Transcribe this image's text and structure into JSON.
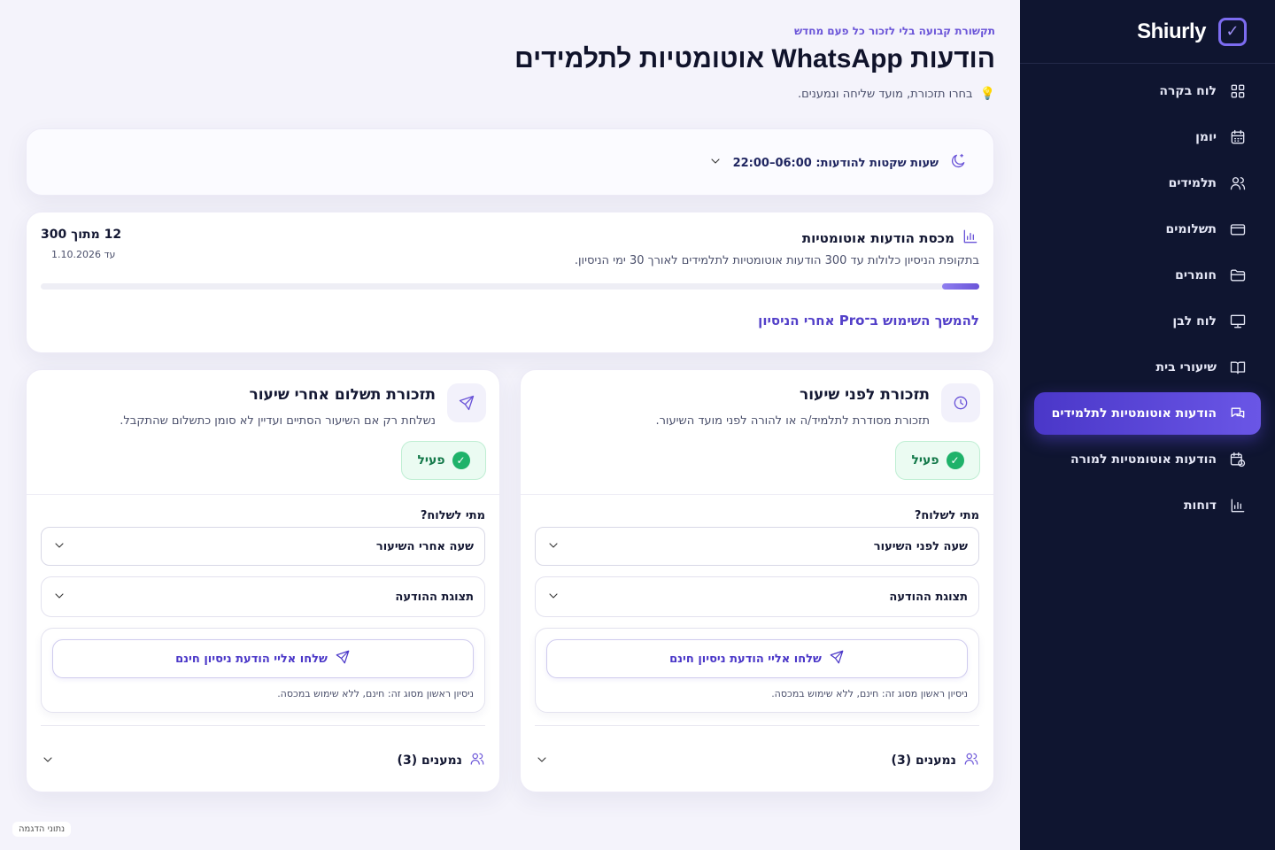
{
  "app": {
    "name": "Shiurly"
  },
  "sidebar": {
    "items": [
      {
        "label": "לוח בקרה",
        "icon": "dashboard-icon",
        "active": false
      },
      {
        "label": "יומן",
        "icon": "calendar-icon",
        "active": false
      },
      {
        "label": "תלמידים",
        "icon": "users-icon",
        "active": false
      },
      {
        "label": "תשלומים",
        "icon": "credit-card-icon",
        "active": false
      },
      {
        "label": "חומרים",
        "icon": "folder-icon",
        "active": false
      },
      {
        "label": "לוח לבן",
        "icon": "whiteboard-icon",
        "active": false
      },
      {
        "label": "שיעורי בית",
        "icon": "book-icon",
        "active": false
      },
      {
        "label": "הודעות אוטומטיות לתלמידים",
        "icon": "chat-icon",
        "active": true
      },
      {
        "label": "הודעות אוטומטיות למורה",
        "icon": "calendar-clock-icon",
        "active": false
      },
      {
        "label": "דוחות",
        "icon": "bar-chart-icon",
        "active": false
      }
    ]
  },
  "header": {
    "eyebrow": "תקשורת קבועה בלי לזכור כל פעם מחדש",
    "title": "הודעות WhatsApp אוטומטיות לתלמידים",
    "hint": "בחרו תזכורת, מועד שליחה ונמענים."
  },
  "quiet_hours": {
    "label": "שעות שקטות להודעות: 06:00–22:00"
  },
  "quota": {
    "title": "מכסת הודעות אוטומטיות",
    "description": "בתקופת הניסיון כלולות עד 300 הודעות אוטומטיות לתלמידים לאורך 30 ימי הניסיון.",
    "count": "12 מתוך 300",
    "until": "עד 1.10.2026",
    "used": 12,
    "total": 300,
    "pro_link": "להמשך השימוש ב־Pro אחרי הניסיון"
  },
  "reminders": [
    {
      "title": "תזכורת לפני שיעור",
      "description": "תזכורת מסודרת לתלמיד/ה או להורה לפני מועד השיעור.",
      "status": "פעיל",
      "when_label": "מתי לשלוח?",
      "when_value": "שעה לפני השיעור",
      "preview_label": "תצוגת ההודעה",
      "trial_button": "שלחו אליי הודעת ניסיון חינם",
      "trial_note": "ניסיון ראשון מסוג זה: חינם, ללא שימוש במכסה.",
      "recipients": "נמענים (3)"
    },
    {
      "title": "תזכורת תשלום אחרי שיעור",
      "description": "נשלחת רק אם השיעור הסתיים ועדיין לא סומן כתשלום שהתקבל.",
      "status": "פעיל",
      "when_label": "מתי לשלוח?",
      "when_value": "שעה אחרי השיעור",
      "preview_label": "תצוגת ההודעה",
      "trial_button": "שלחו אליי הודעת ניסיון חינם",
      "trial_note": "ניסיון ראשון מסוג זה: חינם, ללא שימוש במכסה.",
      "recipients": "נמענים (3)"
    }
  ],
  "demo_badge": "נתוני הדגמה"
}
